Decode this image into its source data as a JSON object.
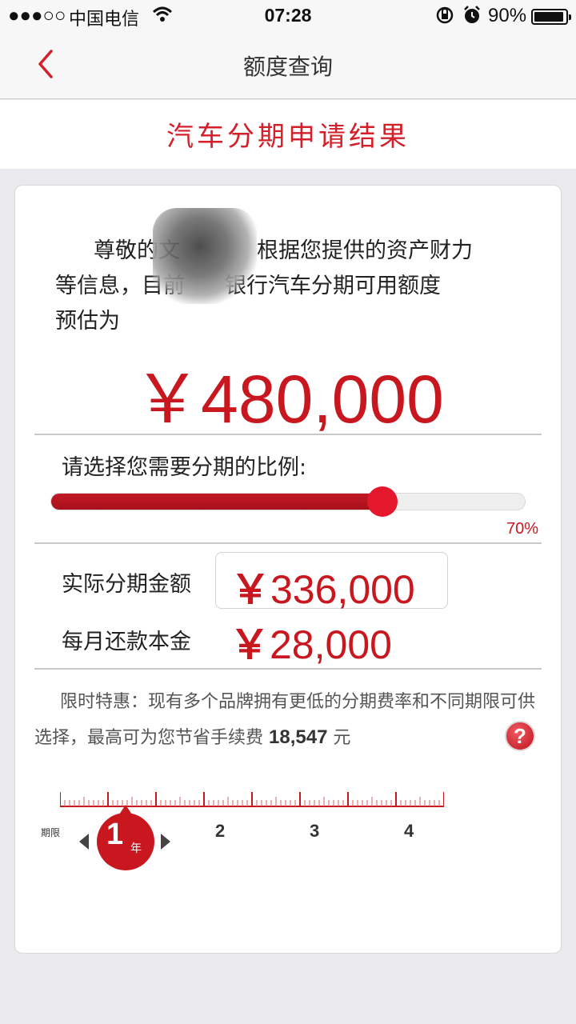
{
  "status_bar": {
    "signal": "●●●○○",
    "carrier": "中国电信",
    "time": "07:28",
    "battery_percent": "90%",
    "icons": [
      "wifi-icon",
      "rotation-lock-icon",
      "alarm-icon",
      "battery-icon"
    ]
  },
  "nav": {
    "back_icon": "chevron-left-icon",
    "title": "额度查询"
  },
  "result_title": "汽车分期申请结果",
  "greeting": {
    "line1": "尊敬的文",
    "line1_rest": "根据您提供的资产财力",
    "line2": "等信息，目前",
    "line2_rest": "银行汽车分期可用额度",
    "line3": "预估为"
  },
  "credit_amount": "￥480,000",
  "ratio": {
    "label": "请选择您需要分期的比例:",
    "percent_text": "70%",
    "value": 0.7
  },
  "actual_amount": {
    "label": "实际分期金额",
    "yen": "￥",
    "value": "336,000"
  },
  "monthly_principal": {
    "label": "每月还款本金",
    "yen": "￥",
    "value": "28,000"
  },
  "promo": {
    "text1": "限时特惠：现有多个品牌拥有更低的分期费率和不同期限可供选择，最高可为您节省手续费",
    "savings": "18,547",
    "unit": "元",
    "help_icon": "question-mark-icon",
    "help_glyph": "?"
  },
  "term": {
    "label": "期限",
    "selected": "1",
    "unit": "年",
    "options": [
      "2",
      "3",
      "4"
    ]
  },
  "colors": {
    "accent": "#c8171f",
    "slider_fill": "#b5121d",
    "slider_thumb": "#e3182d"
  }
}
